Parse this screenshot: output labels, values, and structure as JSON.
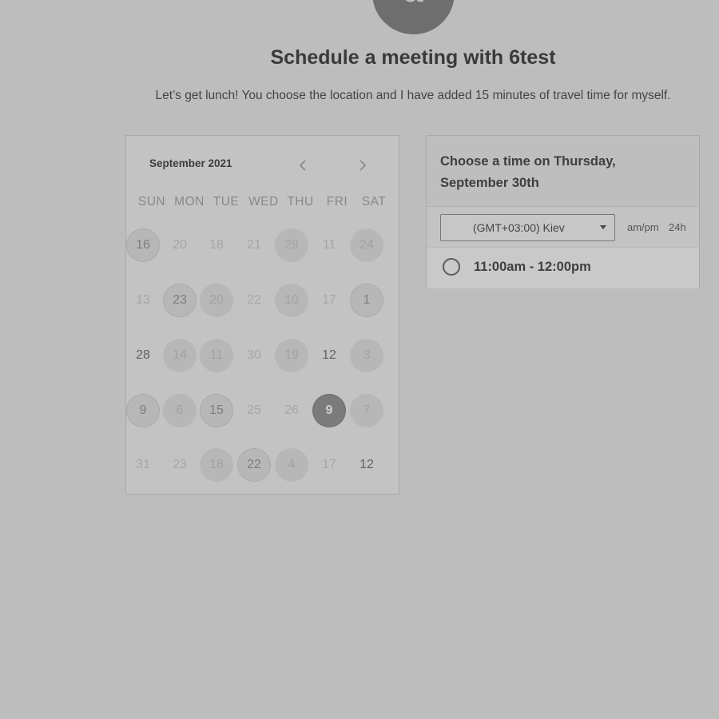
{
  "header": {
    "avatar_initial": "a",
    "title": "Schedule a meeting with 6test",
    "subtitle": "Let’s get lunch! You choose the location and I have added 15 minutes of travel time for myself."
  },
  "calendar": {
    "month": "September 2021",
    "weekdays": [
      "SUN",
      "MON",
      "TUE",
      "WED",
      "THU",
      "FRI",
      "SAT"
    ],
    "weeks": [
      [
        {
          "label": "16",
          "state": "avail-dotted"
        },
        {
          "label": "20",
          "state": "off"
        },
        {
          "label": "18",
          "state": "off"
        },
        {
          "label": "21",
          "state": "off"
        },
        {
          "label": "29",
          "state": "avail"
        },
        {
          "label": "11",
          "state": "off"
        },
        {
          "label": "24",
          "state": "avail"
        }
      ],
      [
        {
          "label": "13",
          "state": "off"
        },
        {
          "label": "23",
          "state": "avail-dotted"
        },
        {
          "label": "20",
          "state": "avail"
        },
        {
          "label": "22",
          "state": "off"
        },
        {
          "label": "10",
          "state": "avail"
        },
        {
          "label": "17",
          "state": "off"
        },
        {
          "label": "1",
          "state": "avail-dotted"
        }
      ],
      [
        {
          "label": "28",
          "state": "bold"
        },
        {
          "label": "14",
          "state": "avail"
        },
        {
          "label": "11",
          "state": "avail"
        },
        {
          "label": "30",
          "state": "off"
        },
        {
          "label": "19",
          "state": "avail"
        },
        {
          "label": "12",
          "state": "bold"
        },
        {
          "label": "3",
          "state": "avail"
        }
      ],
      [
        {
          "label": "9",
          "state": "avail-dotted"
        },
        {
          "label": "6",
          "state": "avail"
        },
        {
          "label": "15",
          "state": "avail-dotted"
        },
        {
          "label": "25",
          "state": "off"
        },
        {
          "label": "26",
          "state": "off"
        },
        {
          "label": "9",
          "state": "selected"
        },
        {
          "label": "7",
          "state": "avail"
        }
      ],
      [
        {
          "label": "31",
          "state": "off"
        },
        {
          "label": "23",
          "state": "off"
        },
        {
          "label": "18",
          "state": "avail"
        },
        {
          "label": "22",
          "state": "avail-dotted"
        },
        {
          "label": "4",
          "state": "avail"
        },
        {
          "label": "17",
          "state": "off"
        },
        {
          "label": "12",
          "state": "bold"
        }
      ]
    ]
  },
  "time_panel": {
    "heading": "Choose a time on Thursday, September 30th",
    "timezone": "(GMT+03:00) Kiev",
    "format_12h": "am/pm",
    "format_24h": "24h",
    "slots": [
      "11:00am - 12:00pm"
    ]
  },
  "colors": {
    "background": "#bdbdbd",
    "selected_day": "#7b7b7b",
    "available_day": "#b7b7b7"
  }
}
